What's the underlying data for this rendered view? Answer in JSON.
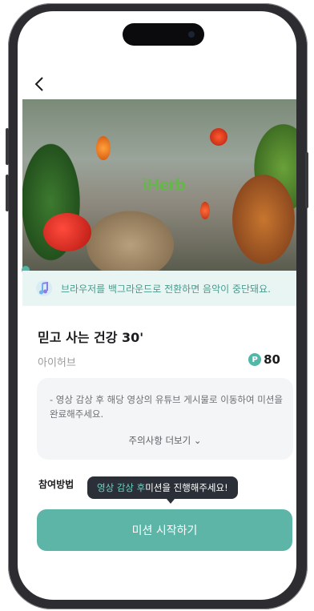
{
  "navigation": {
    "back_icon": "chevron-left-icon"
  },
  "video": {
    "brand_watermark": "iHerb"
  },
  "notice": {
    "icon": "music-note-icon",
    "text": "브라우저를 백그라운드로 전환하면 음악이 중단돼요."
  },
  "mission": {
    "title": "믿고 사는 건강 30'",
    "brand": "아이허브",
    "points_badge": "P",
    "points": "80"
  },
  "caution": {
    "text": "- 영상 감상 후 해당 영상의 유튜브 게시물로 이동하여 미션을 완료해주세요.",
    "more_label": "주의사항 더보기 ⌄"
  },
  "method_label": "참여방법",
  "tooltip": {
    "highlight": "영상 감상 후",
    "rest": " 미션을 진행해주세요!"
  },
  "cta_label": "미션 시작하기",
  "colors": {
    "accent": "#5cb5a7",
    "notice_bg": "#e9f5f2",
    "tooltip_bg": "#2b3038"
  }
}
